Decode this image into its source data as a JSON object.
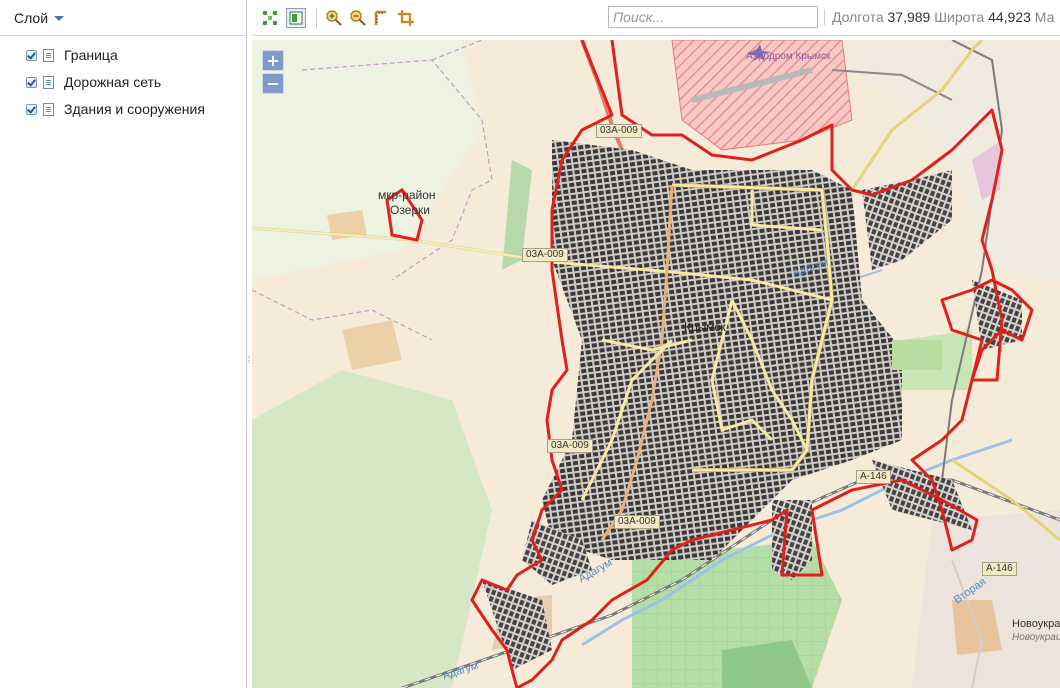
{
  "layers_panel": {
    "title": "Слой",
    "items": [
      {
        "label": "Граница",
        "checked": true
      },
      {
        "label": "Дорожная сеть",
        "checked": true
      },
      {
        "label": "Здания и сооружения",
        "checked": true
      }
    ]
  },
  "toolbar": {
    "buttons": [
      "zoom-to-extent-icon",
      "layer-icon",
      "zoom-in-icon",
      "zoom-out-icon",
      "measure-distance-icon",
      "measure-area-icon"
    ],
    "search_placeholder": "Поиск...",
    "search_value": "",
    "longitude_label": "Долгота",
    "longitude_value": "37,989",
    "latitude_label": "Широта",
    "latitude_value": "44,923",
    "scale_label": "Ма"
  },
  "map": {
    "zoom_in": "+",
    "zoom_out": "−",
    "labels": {
      "airport": "Аэродром Крымск",
      "microdistrict_1": "мкр-район",
      "microdistrict_2": "Озерки",
      "river_1": "Адагум",
      "river_2": "Адагум",
      "river_3": "Адагум",
      "river_4": "Вторая",
      "town": "Новоукраинский",
      "town_2": "Новоукраинский",
      "city_center": "Крымск"
    },
    "road_refs": [
      "03А-009",
      "03А-009",
      "03А-009",
      "03А-009",
      "А-146",
      "А-146"
    ],
    "colors": {
      "boundary": "#e0201c",
      "roads_main": "#f5e9a4",
      "buildings": "#444444",
      "landuse_green": "#cde7bb",
      "residential": "#e8ddd6",
      "airport_hatch": "#f2a8a8",
      "railway": "#7a7a7a",
      "river": "#9bc3e6",
      "background": "#f3ede0"
    }
  }
}
